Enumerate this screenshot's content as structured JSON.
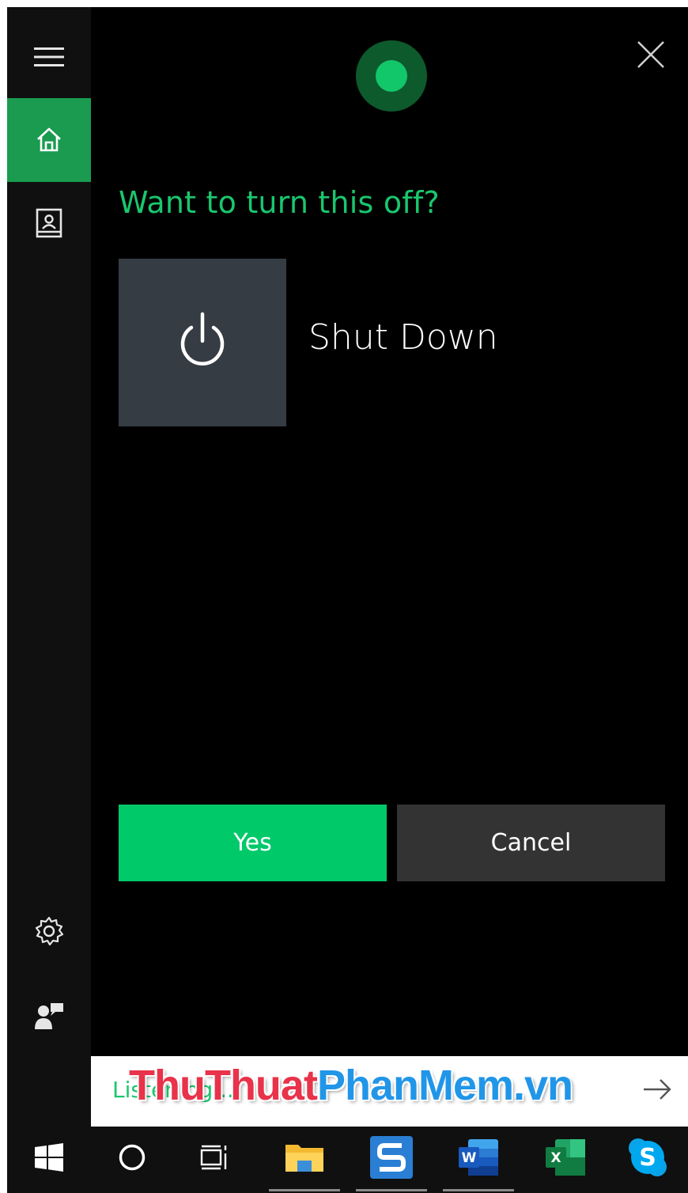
{
  "colors": {
    "accent": "#19c76e",
    "yes_button": "#00c96a",
    "cancel_button": "#333333",
    "sidebar_selected": "#1a9b50",
    "tile_background": "#363c43",
    "panel_background": "#000000"
  },
  "sidebar": {
    "items": [
      {
        "name": "menu",
        "icon": "hamburger-icon"
      },
      {
        "name": "home",
        "icon": "home-icon",
        "selected": true
      },
      {
        "name": "notebook",
        "icon": "notebook-icon"
      },
      {
        "name": "settings",
        "icon": "gear-icon"
      },
      {
        "name": "feedback",
        "icon": "feedback-icon"
      }
    ]
  },
  "header": {
    "orb_icon": "cortana-orb-icon",
    "close_icon": "close-icon"
  },
  "main": {
    "question": "Want to turn this off?",
    "tile_icon": "power-icon",
    "tile_label": "Shut Down",
    "yes_label": "Yes",
    "cancel_label": "Cancel"
  },
  "listen_bar": {
    "status_text": "Listening...",
    "watermark_part1": "ThuThuat",
    "watermark_part2": "PhanMem",
    "watermark_part3": ".vn",
    "arrow_icon": "arrow-right-icon"
  },
  "taskbar": {
    "items": [
      {
        "name": "start",
        "icon": "windows-icon"
      },
      {
        "name": "cortana",
        "icon": "circle-icon"
      },
      {
        "name": "task-view",
        "icon": "task-view-icon"
      },
      {
        "name": "file-explorer",
        "icon": "folder-icon"
      },
      {
        "name": "snagit",
        "icon": "snagit-icon"
      },
      {
        "name": "word",
        "icon": "word-icon",
        "letter": "W"
      },
      {
        "name": "excel",
        "icon": "excel-icon",
        "letter": "X"
      },
      {
        "name": "skype",
        "icon": "skype-icon",
        "letter": "S"
      }
    ]
  }
}
